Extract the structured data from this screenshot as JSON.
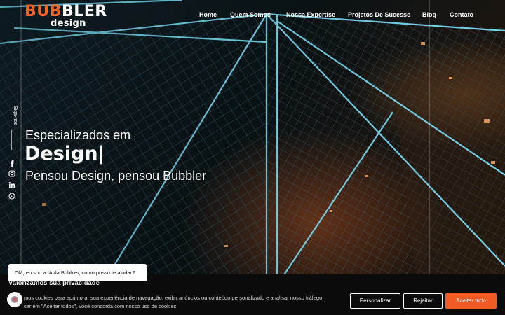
{
  "brand": {
    "logo_main": "BUBBLER",
    "logo_sub": "design",
    "accent_color": "#f26522"
  },
  "nav": {
    "items": [
      {
        "label": "Home"
      },
      {
        "label": "Quem Somos"
      },
      {
        "label": "Nossa Expertise"
      },
      {
        "label": "Projetos De Sucesso"
      },
      {
        "label": "Blog"
      },
      {
        "label": "Contato"
      }
    ]
  },
  "social": {
    "label": "Siga-nos",
    "icons": [
      "facebook-icon",
      "instagram-icon",
      "linkedin-icon",
      "whatsapp-icon"
    ]
  },
  "hero": {
    "line1": "Especializados em",
    "line2": "Design",
    "cursor": "|",
    "line3": "Pensou Design, pensou Bubbler"
  },
  "chat": {
    "bubble_text": "Olá, eu sou a IA da Bubbler, como posso te ajudar?"
  },
  "cookie": {
    "title": "Valorizamos sua privacidade",
    "text_line1": "mos cookies para aprimorar sua experiência de navegação, exibir anúncios ou conteúdo personalizado e analisar nosso tráfego.",
    "text_line2": "car em \"Aceitar todos\", você concorda com nosso uso de cookies.",
    "customize_label": "Personalizar",
    "reject_label": "Rejeitar",
    "accept_label": "Aceitar tudo",
    "accept_color": "#f15a24"
  }
}
